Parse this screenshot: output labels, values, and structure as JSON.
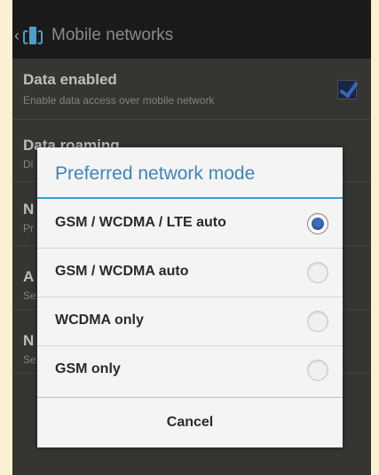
{
  "action_bar": {
    "title": "Mobile networks"
  },
  "settings": [
    {
      "title": "Data enabled",
      "summary": "Enable data access over mobile network",
      "checked": true
    },
    {
      "title": "Data roaming",
      "summary": "Di"
    },
    {
      "title": "N",
      "summary": "Pr"
    },
    {
      "title": "A",
      "summary": "Se"
    },
    {
      "title": "N",
      "summary": "Se"
    }
  ],
  "dialog": {
    "title": "Preferred network mode",
    "options": [
      {
        "label": "GSM / WCDMA / LTE auto",
        "selected": true
      },
      {
        "label": "GSM / WCDMA auto",
        "selected": false
      },
      {
        "label": "WCDMA only",
        "selected": false
      },
      {
        "label": "GSM only",
        "selected": false
      }
    ],
    "cancel_label": "Cancel"
  },
  "colors": {
    "accent": "#3a9fd0",
    "title_text": "#3c86b8",
    "radio_on": "#3a6fbf"
  }
}
